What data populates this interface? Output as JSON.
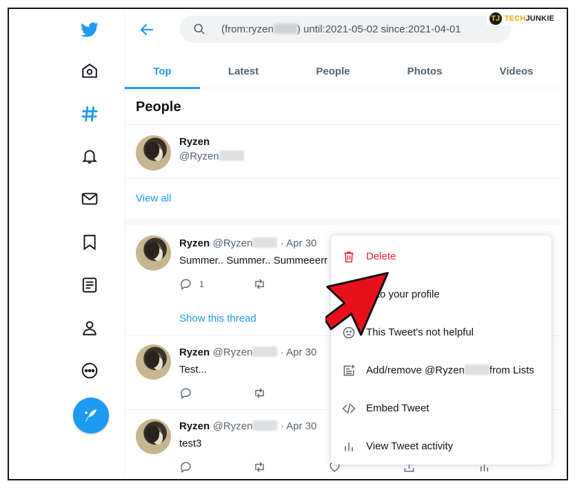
{
  "watermark": {
    "logo": "TJ",
    "text_a": "TECH",
    "text_b": "JUNKIE"
  },
  "rail": {
    "icons": [
      "twitter-logo-icon",
      "home-icon",
      "explore-hashtag-icon",
      "notifications-bell-icon",
      "messages-mail-icon",
      "bookmarks-icon",
      "lists-icon",
      "profile-icon",
      "more-circle-icon"
    ],
    "compose_icon": "compose-feather-icon"
  },
  "header": {
    "search_prefix": "(from:ryzen",
    "search_suffix": ") until:2021-05-02 since:2021-04-01",
    "more_icon": "more-dots-icon"
  },
  "tabs": [
    {
      "label": "Top",
      "active": true
    },
    {
      "label": "Latest"
    },
    {
      "label": "People"
    },
    {
      "label": "Photos"
    },
    {
      "label": "Videos"
    }
  ],
  "people": {
    "title": "People",
    "user_name": "Ryzen",
    "user_handle": "@Ryzen",
    "view_all": "View all"
  },
  "tweets": [
    {
      "name": "Ryzen",
      "handle": "@Ryzen",
      "date": "· Apr 30",
      "text": "Summer.. Summer.. Summeeerr",
      "reply_count": "1",
      "thread_link": "Show this thread"
    },
    {
      "name": "Ryzen",
      "handle": "@Ryzen",
      "date": "· Apr 30",
      "text": "Test..."
    },
    {
      "name": "Ryzen",
      "handle": "@Ryzen",
      "date": "· Apr 30",
      "text": "test3"
    }
  ],
  "menu": {
    "items": [
      {
        "label": "Delete",
        "icon": "trash-icon",
        "color": "#f4212e"
      },
      {
        "label": "in to your profile",
        "icon": "pin-icon"
      },
      {
        "label": "This Tweet's not helpful",
        "icon": "sad-face-icon"
      },
      {
        "label_prefix": "Add/remove @Ryzen",
        "label_suffix": "from Lists",
        "icon": "list-add-icon"
      },
      {
        "label": "Embed Tweet",
        "icon": "code-icon"
      },
      {
        "label": "View Tweet activity",
        "icon": "bar-chart-icon"
      }
    ]
  },
  "colors": {
    "accent": "#1d9bf0",
    "danger": "#f4212e",
    "arrow": "#e8101a"
  }
}
